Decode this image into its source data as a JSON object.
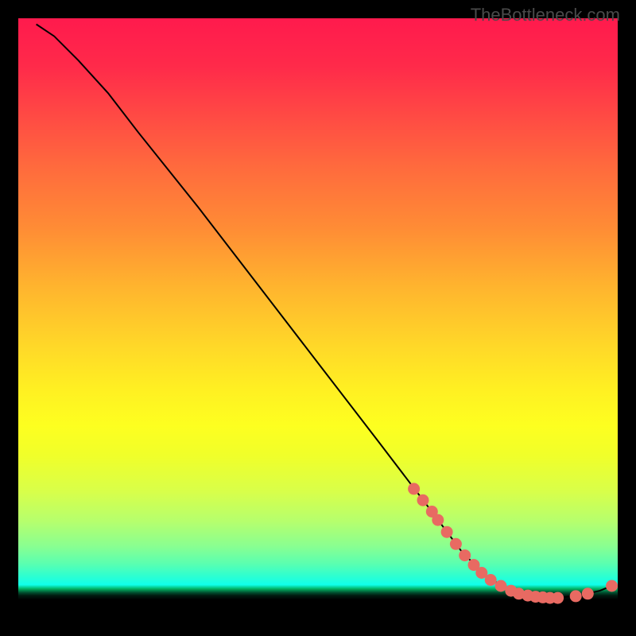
{
  "watermark": "TheBottleneck.com",
  "chart_data": {
    "type": "line",
    "title": "",
    "xlabel": "",
    "ylabel": "",
    "xlim": [
      0,
      100
    ],
    "ylim": [
      0,
      100
    ],
    "curve": [
      {
        "x": 3.0,
        "y": 99.0
      },
      {
        "x": 6.0,
        "y": 97.0
      },
      {
        "x": 10.0,
        "y": 93.0
      },
      {
        "x": 15.0,
        "y": 87.5
      },
      {
        "x": 20.0,
        "y": 81.0
      },
      {
        "x": 30.0,
        "y": 68.5
      },
      {
        "x": 40.0,
        "y": 55.5
      },
      {
        "x": 50.0,
        "y": 42.5
      },
      {
        "x": 60.0,
        "y": 29.5
      },
      {
        "x": 68.0,
        "y": 19.0
      },
      {
        "x": 74.0,
        "y": 11.0
      },
      {
        "x": 78.0,
        "y": 7.0
      },
      {
        "x": 82.0,
        "y": 4.5
      },
      {
        "x": 86.0,
        "y": 3.5
      },
      {
        "x": 90.0,
        "y": 3.3
      },
      {
        "x": 94.0,
        "y": 3.8
      },
      {
        "x": 97.0,
        "y": 4.5
      },
      {
        "x": 99.0,
        "y": 5.3
      }
    ],
    "markers": [
      {
        "x": 66.0,
        "y": 21.5
      },
      {
        "x": 67.5,
        "y": 19.6
      },
      {
        "x": 69.0,
        "y": 17.7
      },
      {
        "x": 70.0,
        "y": 16.3
      },
      {
        "x": 71.5,
        "y": 14.3
      },
      {
        "x": 73.0,
        "y": 12.3
      },
      {
        "x": 74.5,
        "y": 10.4
      },
      {
        "x": 76.0,
        "y": 8.8
      },
      {
        "x": 77.3,
        "y": 7.5
      },
      {
        "x": 78.8,
        "y": 6.3
      },
      {
        "x": 80.5,
        "y": 5.3
      },
      {
        "x": 82.2,
        "y": 4.5
      },
      {
        "x": 83.5,
        "y": 4.0
      },
      {
        "x": 85.0,
        "y": 3.7
      },
      {
        "x": 86.3,
        "y": 3.5
      },
      {
        "x": 87.5,
        "y": 3.4
      },
      {
        "x": 88.7,
        "y": 3.3
      },
      {
        "x": 90.0,
        "y": 3.3
      },
      {
        "x": 93.0,
        "y": 3.6
      },
      {
        "x": 95.0,
        "y": 4.0
      },
      {
        "x": 99.0,
        "y": 5.3
      }
    ],
    "marker_color": "#e86a62",
    "curve_color": "#000000"
  }
}
